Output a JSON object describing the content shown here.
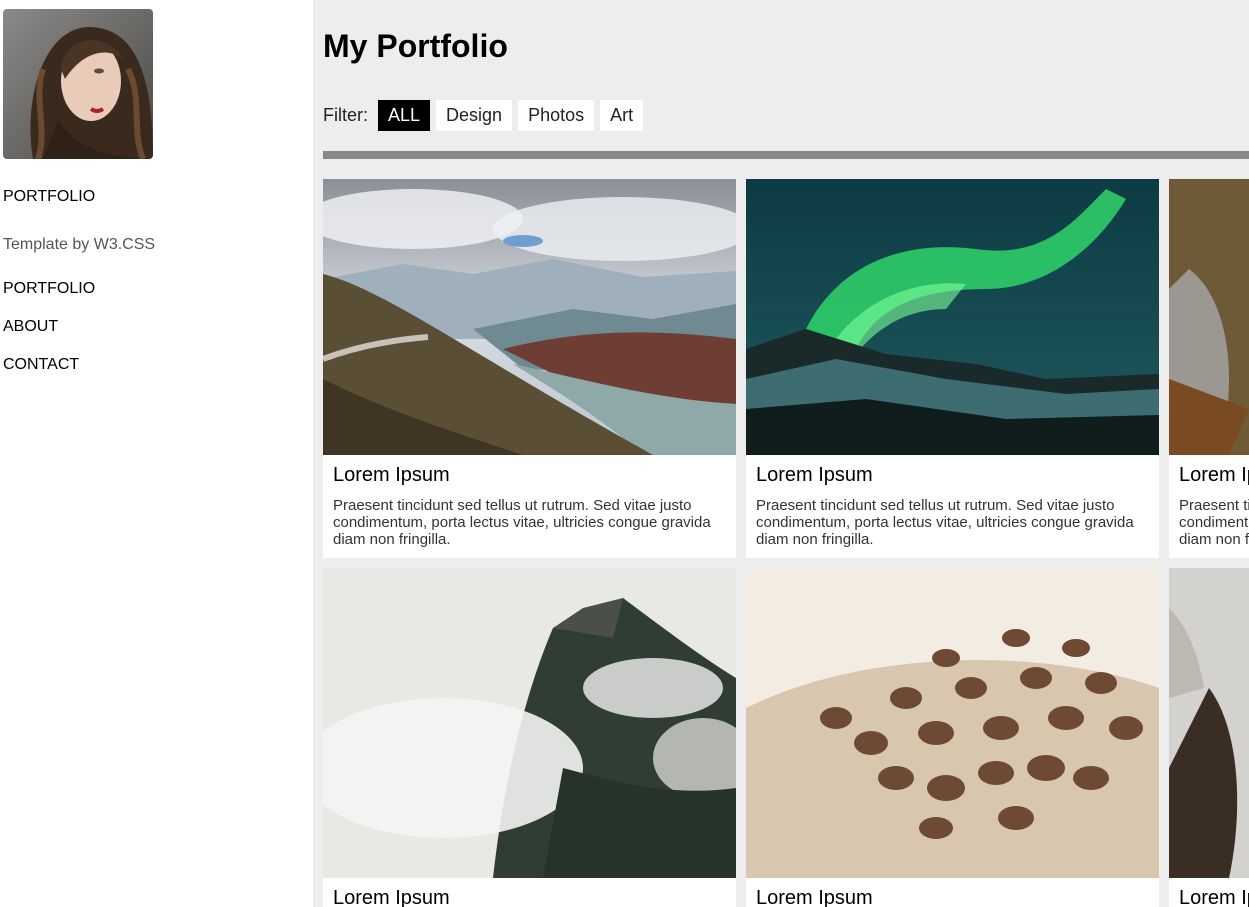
{
  "sidebar": {
    "brand": "PORTFOLIO",
    "credit": "Template by W3.CSS",
    "nav": [
      {
        "label": "PORTFOLIO"
      },
      {
        "label": "ABOUT"
      },
      {
        "label": "CONTACT"
      }
    ]
  },
  "main": {
    "title": "My Portfolio",
    "filter": {
      "label": "Filter:",
      "options": [
        "ALL",
        "Design",
        "Photos",
        "Art"
      ],
      "active": "ALL"
    },
    "cards": [
      {
        "title": "Lorem Ipsum",
        "text": "Praesent tincidunt sed tellus ut rutrum. Sed vitae justo condimentum, porta lectus vitae, ultricies congue gravida diam non fringilla.",
        "image": "mountain-lake-photo"
      },
      {
        "title": "Lorem Ipsum",
        "text": "Praesent tincidunt sed tellus ut rutrum. Sed vitae justo condimentum, porta lectus vitae, ultricies congue gravida diam non fringilla.",
        "image": "aurora-photo"
      },
      {
        "title": "Lorem Ipsum",
        "text": "Praesent tincidunt sed tellus ut rutrum. Sed vitae justo condimentum, porta lectus vitae, ultricies congue gravida diam non fringilla.",
        "image": "sunlit-cliff-photo"
      },
      {
        "title": "Lorem Ipsum",
        "text": "",
        "image": "misty-forest-photo"
      },
      {
        "title": "Lorem Ipsum",
        "text": "",
        "image": "coffee-beans-photo"
      },
      {
        "title": "Lorem Ipsum",
        "text": "",
        "image": "bear-photo"
      }
    ]
  },
  "colors": {
    "main_bg": "#ededed",
    "active_filter_bg": "#000000",
    "divider": "#888888"
  }
}
